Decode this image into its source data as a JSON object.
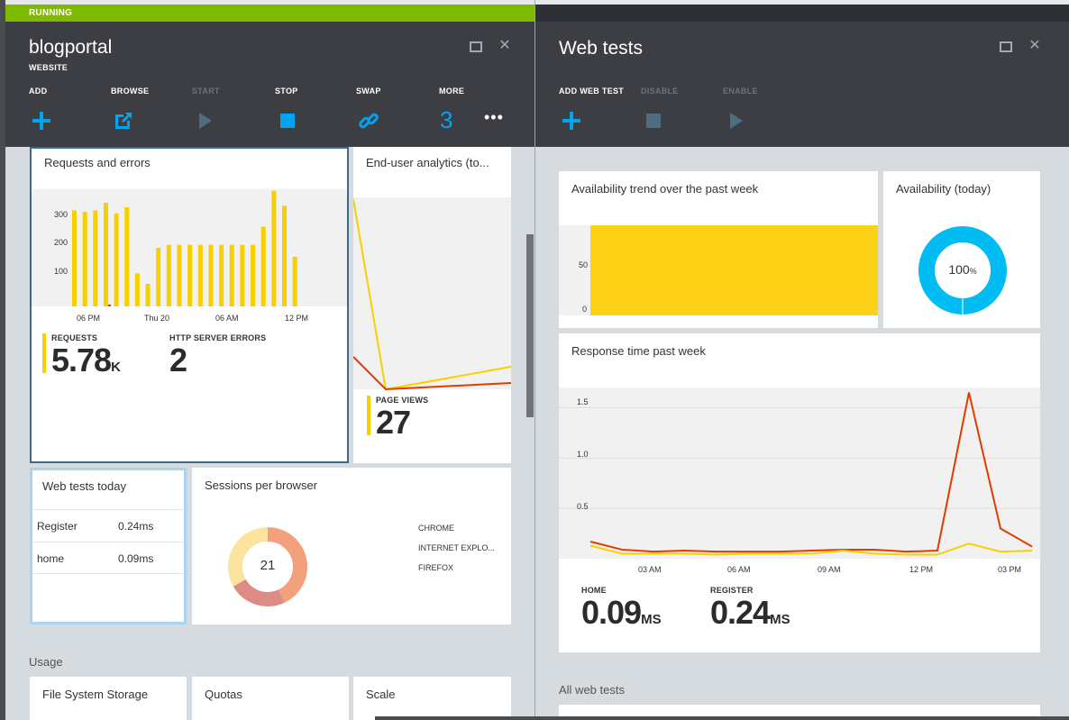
{
  "left": {
    "status": "RUNNING",
    "title": "blogportal",
    "subtitle": "WEBSITE",
    "commands": [
      {
        "label": "ADD",
        "icon": "plus-icon",
        "enabled": true
      },
      {
        "label": "BROWSE",
        "icon": "browse-external-icon",
        "enabled": true
      },
      {
        "label": "START",
        "icon": "play-icon",
        "enabled": false
      },
      {
        "label": "STOP",
        "icon": "stop-icon",
        "enabled": true
      },
      {
        "label": "SWAP",
        "icon": "link-swap-icon",
        "enabled": true
      },
      {
        "label": "MORE",
        "icon": "more-icon",
        "enabled": true,
        "count": "3"
      }
    ],
    "requests_tile": {
      "title": "Requests and errors",
      "y_ticks": [
        "300",
        "200",
        "100"
      ],
      "x_ticks": [
        "06 PM",
        "Thu 20",
        "06 AM",
        "12 PM"
      ],
      "requests_label": "REQUESTS",
      "requests_value": "5.78",
      "requests_unit": "K",
      "errors_label": "HTTP SERVER ERRORS",
      "errors_value": "2"
    },
    "enduser_tile": {
      "title": "End-user analytics (to...",
      "pageviews_label": "PAGE VIEWS",
      "pageviews_value": "27"
    },
    "webtests_tile": {
      "title": "Web tests today",
      "rows": [
        {
          "name": "Register",
          "value": "0.24ms"
        },
        {
          "name": "home",
          "value": "0.09ms"
        }
      ]
    },
    "sessions_tile": {
      "title": "Sessions per browser",
      "total": "21",
      "legend": [
        "CHROME",
        "INTERNET EXPLO...",
        "FIREFOX"
      ]
    },
    "usage_label": "Usage",
    "usage_tiles": [
      "File System Storage",
      "Quotas",
      "Scale"
    ]
  },
  "right": {
    "title": "Web tests",
    "commands": [
      {
        "label": "ADD WEB TEST",
        "icon": "plus-icon",
        "enabled": true
      },
      {
        "label": "DISABLE",
        "icon": "stop-icon",
        "enabled": false
      },
      {
        "label": "ENABLE",
        "icon": "play-icon",
        "enabled": false
      }
    ],
    "trend_tile": {
      "title": "Availability trend over the past week",
      "y_ticks": [
        "50",
        "0"
      ]
    },
    "availability_tile": {
      "title": "Availability (today)",
      "value": "100",
      "unit": "%"
    },
    "response_tile": {
      "title": "Response time past week",
      "y_ticks": [
        "1.5",
        "1.0",
        "0.5"
      ],
      "x_ticks": [
        "03 AM",
        "06 AM",
        "09 AM",
        "12 PM",
        "03 PM"
      ],
      "home_label": "HOME",
      "home_value": "0.09",
      "home_unit": "MS",
      "register_label": "REGISTER",
      "register_value": "0.24",
      "register_unit": "MS"
    },
    "all_tests_label": "All web tests"
  },
  "colors": {
    "status_green": "#7fba00",
    "header_dark": "#3c3e43",
    "accent_blue": "#00a4ef",
    "requests_yellow": "#f8d000",
    "error_red": "#e03c00",
    "availability_cyan": "#00bcf2"
  },
  "chart_data": [
    {
      "type": "bar",
      "title": "Requests and errors",
      "xticks": [
        "06 PM",
        "Thu 20",
        "06 AM",
        "12 PM"
      ],
      "ylim": [
        0,
        390
      ],
      "series": [
        {
          "name": "REQUESTS",
          "values": [
            320,
            315,
            320,
            345,
            310,
            330,
            110,
            75,
            195,
            205,
            205,
            205,
            205,
            205,
            205,
            205,
            205,
            205,
            265,
            385,
            335,
            165
          ]
        },
        {
          "name": "HTTP SERVER ERRORS",
          "values": [
            0,
            0,
            0,
            2,
            0,
            0,
            0,
            0,
            0,
            0,
            0,
            0,
            0,
            0,
            0,
            0,
            0,
            0,
            0,
            0,
            0,
            0
          ]
        }
      ]
    },
    {
      "type": "line",
      "title": "Response time past week",
      "xticks": [
        "03 AM",
        "06 AM",
        "09 AM",
        "12 PM",
        "03 PM"
      ],
      "ylim": [
        0,
        1.7
      ],
      "series": [
        {
          "name": "REGISTER",
          "values": [
            0.17,
            0.09,
            0.07,
            0.08,
            0.07,
            0.07,
            0.07,
            0.08,
            0.09,
            0.09,
            0.07,
            0.08,
            1.65,
            0.3,
            0.12
          ]
        },
        {
          "name": "HOME",
          "values": [
            0.13,
            0.05,
            0.05,
            0.05,
            0.04,
            0.05,
            0.05,
            0.05,
            0.08,
            0.05,
            0.04,
            0.04,
            0.15,
            0.07,
            0.08
          ]
        }
      ]
    },
    {
      "type": "pie",
      "title": "Sessions per browser",
      "categories": [
        "CHROME",
        "INTERNET EXPLO...",
        "FIREFOX"
      ],
      "values": [
        9,
        5,
        7
      ]
    },
    {
      "type": "bar",
      "title": "Availability trend over the past week",
      "ylim": [
        0,
        100
      ],
      "values": [
        100
      ]
    }
  ]
}
